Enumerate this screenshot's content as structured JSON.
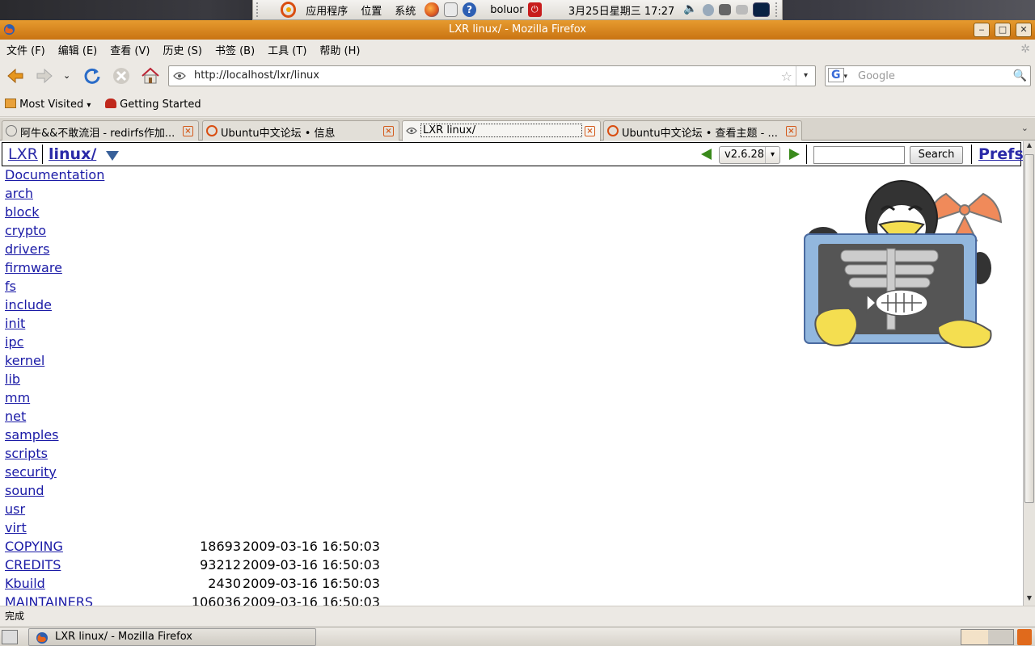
{
  "top_panel": {
    "menu_apps": "应用程序",
    "menu_places": "位置",
    "menu_system": "系统",
    "username": "boluor",
    "clock": "3月25日星期三 17:27",
    "icons": [
      "ubuntu-logo-icon",
      "firefox-icon",
      "mail-icon",
      "help-icon",
      "power-icon",
      "volume-icon",
      "network-icon",
      "display-icon",
      "printer-icon",
      "cpu-monitor-icon"
    ]
  },
  "window": {
    "title": "LXR linux/ - Mozilla Firefox"
  },
  "menubar": {
    "file": "文件 (F)",
    "edit": "编辑 (E)",
    "view": "查看 (V)",
    "history": "历史 (S)",
    "bookmarks": "书签 (B)",
    "tools": "工具 (T)",
    "help": "帮助 (H)"
  },
  "navbar": {
    "url": "http://localhost/lxr/linux",
    "search_placeholder": "Google"
  },
  "bookmarks_bar": {
    "most_visited": "Most Visited",
    "getting_started": "Getting Started"
  },
  "tabs": [
    {
      "label": "阿牛&&不敢流泪 - redirfs作加...",
      "active": false
    },
    {
      "label": "Ubuntu中文论坛 • 信息",
      "active": false
    },
    {
      "label": "LXR linux/",
      "active": true
    },
    {
      "label": "Ubuntu中文论坛 • 查看主题 - ...",
      "active": false
    }
  ],
  "lxr": {
    "home_link": "LXR",
    "path_link": "linux/",
    "version": "v2.6.28",
    "search_button": "Search",
    "search_value": "",
    "prefs_link": "Prefs",
    "directories": [
      "Documentation",
      "arch",
      "block",
      "crypto",
      "drivers",
      "firmware",
      "fs",
      "include",
      "init",
      "ipc",
      "kernel",
      "lib",
      "mm",
      "net",
      "samples",
      "scripts",
      "security",
      "sound",
      "usr",
      "virt"
    ],
    "files": [
      {
        "name": "COPYING",
        "size": "18693",
        "date": "2009-03-16 16:50:03"
      },
      {
        "name": "CREDITS",
        "size": "93212",
        "date": "2009-03-16 16:50:03"
      },
      {
        "name": "Kbuild",
        "size": "2430",
        "date": "2009-03-16 16:50:03"
      },
      {
        "name": "MAINTAINERS",
        "size": "106036",
        "date": "2009-03-16 16:50:03"
      }
    ]
  },
  "statusbar": {
    "text": "完成"
  },
  "taskbar": {
    "window_button": "LXR linux/ - Mozilla Firefox"
  }
}
